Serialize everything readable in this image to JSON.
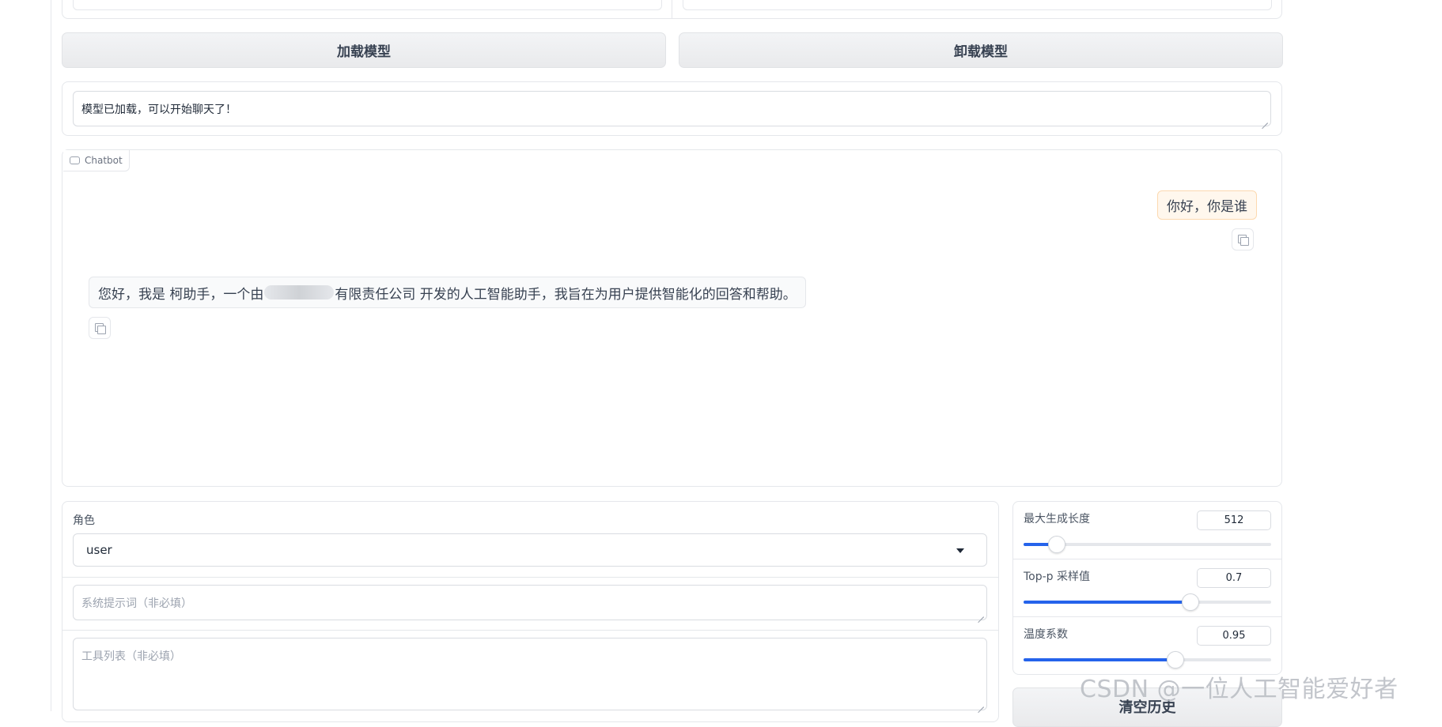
{
  "buttons": {
    "load_model": "加载模型",
    "unload_model": "卸载模型",
    "clear_history": "清空历史"
  },
  "status": {
    "text": "模型已加载，可以开始聊天了！"
  },
  "chatbot": {
    "label": "Chatbot",
    "messages": [
      {
        "role": "user",
        "text": "你好，你是谁"
      },
      {
        "role": "assistant",
        "text_before": "您好，我是 柯助手，一个由",
        "text_after": "有限责任公司 开发的人工智能助手，我旨在为用户提供智能化的回答和帮助。"
      }
    ]
  },
  "inputs": {
    "role_label": "角色",
    "role_value": "user",
    "system_prompt_placeholder": "系统提示词（非必填）",
    "tools_placeholder": "工具列表（非必填）"
  },
  "sliders": [
    {
      "label": "最大生成长度",
      "value": "512",
      "fraction": 0.13
    },
    {
      "label": "Top-p 采样值",
      "value": "0.7",
      "fraction": 0.67
    },
    {
      "label": "温度系数",
      "value": "0.95",
      "fraction": 0.61
    }
  ],
  "watermark": "CSDN @一位人工智能爱好者",
  "colors": {
    "accent": "#2563eb",
    "user_bubble_bg": "#fff7ed",
    "user_bubble_border": "#fcd9b0"
  }
}
